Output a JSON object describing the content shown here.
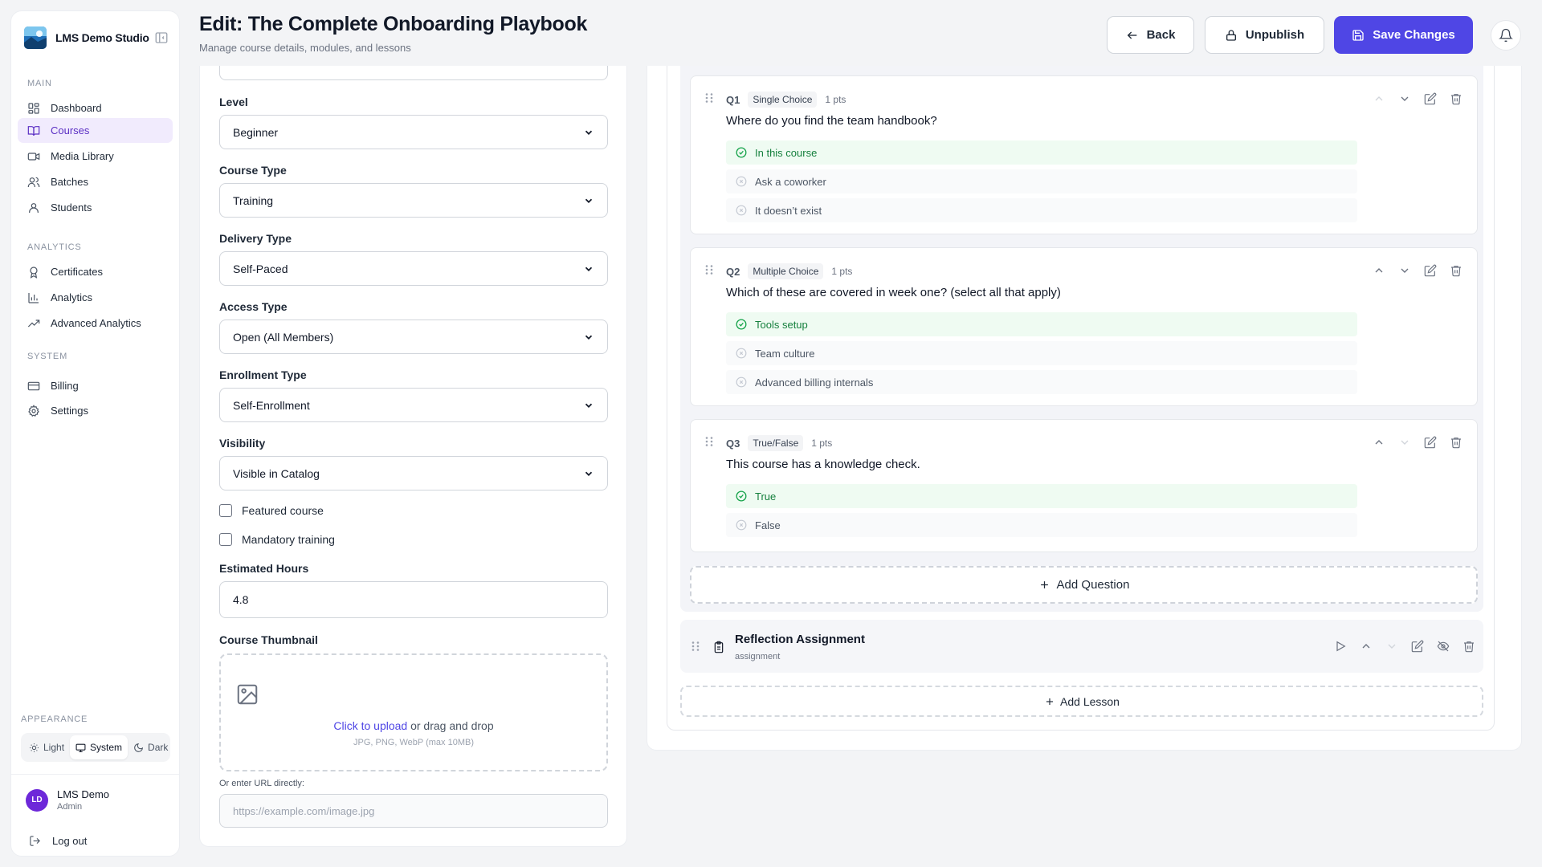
{
  "brand": {
    "name": "LMS Demo Studio"
  },
  "sidebar": {
    "sections": [
      {
        "label": "MAIN"
      },
      {
        "label": "ANALYTICS"
      },
      {
        "label": "SYSTEM"
      }
    ],
    "items": [
      {
        "label": "Dashboard",
        "icon": "dashboard-icon"
      },
      {
        "label": "Courses",
        "icon": "book-icon",
        "active": true
      },
      {
        "label": "Media Library",
        "icon": "video-icon"
      },
      {
        "label": "Batches",
        "icon": "users-icon"
      },
      {
        "label": "Students",
        "icon": "user-icon"
      },
      {
        "label": "Certificates",
        "icon": "award-icon"
      },
      {
        "label": "Analytics",
        "icon": "bar-chart-icon"
      },
      {
        "label": "Advanced Analytics",
        "icon": "trending-up-icon"
      },
      {
        "label": "Billing",
        "icon": "credit-card-icon"
      },
      {
        "label": "Settings",
        "icon": "gear-icon"
      }
    ],
    "appearance": {
      "label": "APPEARANCE",
      "options": [
        "Light",
        "System",
        "Dark"
      ],
      "selected": "System"
    },
    "user": {
      "initials": "LD",
      "name": "LMS Demo",
      "role": "Admin"
    },
    "logout_label": "Log out"
  },
  "header": {
    "title": "Edit: The Complete Onboarding Playbook",
    "subtitle": "Manage course details, modules, and lessons",
    "back_label": "Back",
    "unpublish_label": "Unpublish",
    "save_label": "Save Changes"
  },
  "form": {
    "level": {
      "label": "Level",
      "value": "Beginner"
    },
    "course_type": {
      "label": "Course Type",
      "value": "Training"
    },
    "delivery_type": {
      "label": "Delivery Type",
      "value": "Self-Paced"
    },
    "access_type": {
      "label": "Access Type",
      "value": "Open (All Members)"
    },
    "enrollment_type": {
      "label": "Enrollment Type",
      "value": "Self-Enrollment"
    },
    "visibility": {
      "label": "Visibility",
      "value": "Visible in Catalog"
    },
    "featured": {
      "label": "Featured course",
      "checked": false
    },
    "mandatory": {
      "label": "Mandatory training",
      "checked": false
    },
    "estimated_hours": {
      "label": "Estimated Hours",
      "value": "4.8"
    },
    "thumbnail": {
      "label": "Course Thumbnail",
      "upload_link": "Click to upload",
      "upload_rest": " or drag and drop",
      "hint": "JPG, PNG, WebP (max 10MB)",
      "url_label": "Or enter URL directly:",
      "url_placeholder": "https://example.com/image.jpg"
    }
  },
  "quiz": {
    "questions": [
      {
        "num": "Q1",
        "type": "Single Choice",
        "points": "1 pts",
        "text": "Where do you find the team handbook?",
        "options": [
          {
            "text": "In this course",
            "correct": true
          },
          {
            "text": "Ask a coworker",
            "correct": false
          },
          {
            "text": "It doesn’t exist",
            "correct": false
          }
        ]
      },
      {
        "num": "Q2",
        "type": "Multiple Choice",
        "points": "1 pts",
        "text": "Which of these are covered in week one? (select all that apply)",
        "options": [
          {
            "text": "Tools setup",
            "correct": true
          },
          {
            "text": "Team culture",
            "correct": false
          },
          {
            "text": "Advanced billing internals",
            "correct": false
          }
        ]
      },
      {
        "num": "Q3",
        "type": "True/False",
        "points": "1 pts",
        "text": "This course has a knowledge check.",
        "options": [
          {
            "text": "True",
            "correct": true
          },
          {
            "text": "False",
            "correct": false
          }
        ]
      }
    ],
    "add_question_label": "Add Question"
  },
  "lesson": {
    "title": "Reflection Assignment",
    "type": "assignment",
    "icon": "clipboard-icon"
  },
  "add_lesson_label": "Add Lesson",
  "colors": {
    "accent": "#4f46e5",
    "active_nav_bg": "#f1ebfd",
    "correct": "#16a34a"
  }
}
